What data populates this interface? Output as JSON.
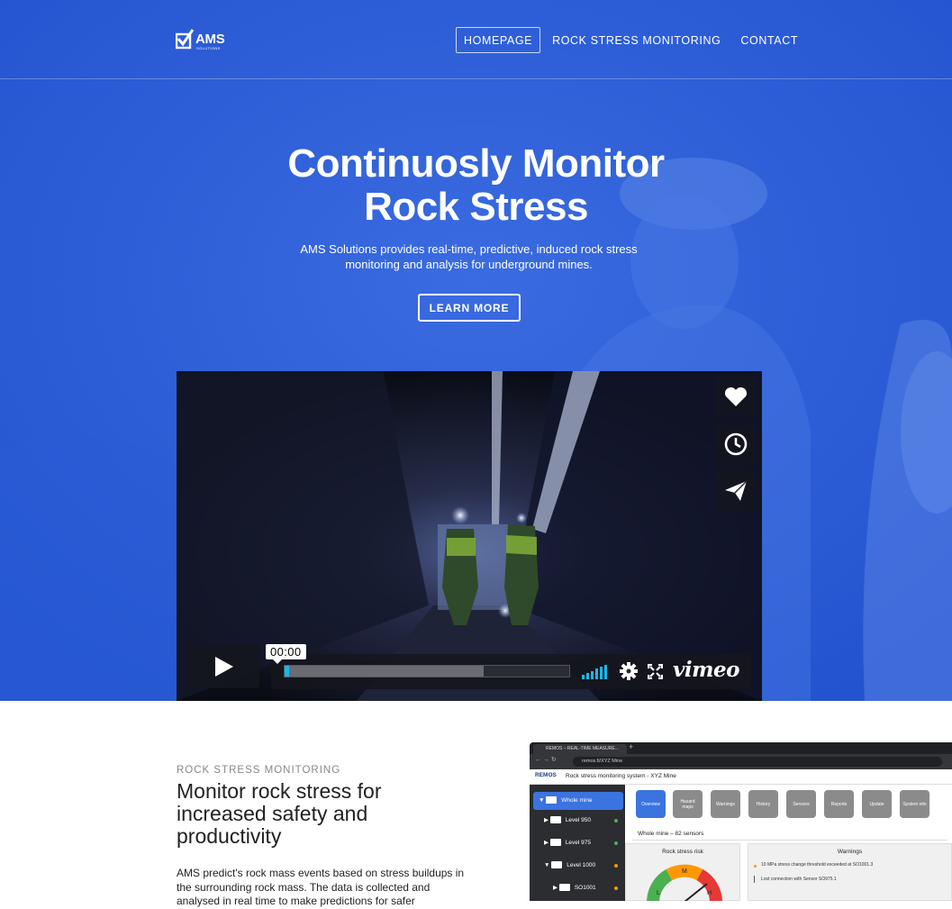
{
  "nav": {
    "logo_text": "AMS",
    "logo_sub": "SOLUTIONS",
    "links": [
      "HOMEPAGE",
      "ROCK STRESS MONITORING",
      "CONTACT"
    ]
  },
  "hero": {
    "title_line1": "Continuosly Monitor",
    "title_line2": "Rock Stress",
    "subtitle_line1": "AMS Solutions provides real-time, predictive, induced rock stress",
    "subtitle_line2": "monitoring and analysis for underground mines.",
    "cta": "LEARN MORE"
  },
  "video": {
    "time": "00:00",
    "brand": "vimeo",
    "progress_buffered": 0.7,
    "progress_played": 0.0,
    "side_icons": [
      "heart-icon",
      "clock-icon",
      "send-icon"
    ]
  },
  "section": {
    "kicker": "ROCK STRESS MONITORING",
    "title": "Monitor rock stress for increased safety and productivity",
    "body": "AMS predict's rock mass events based on stress buildups in the surrounding rock mass. The data is collected and analysed in real time to make predictions for safer"
  },
  "app_screenshot": {
    "tab_title": "REMOS – REAL-TIME MEASURE...",
    "url": "remos.fi/XYZ Mine",
    "logo": "REMOS",
    "header_title": "Rock stress monitoring system - XYZ Mine",
    "sidebar": [
      {
        "label": "Whole mine",
        "dot": ""
      },
      {
        "label": "Level 950",
        "dot": "#4caf50"
      },
      {
        "label": "Level 975",
        "dot": "#4caf50"
      },
      {
        "label": "Level 1000",
        "dot": "#ff9800"
      },
      {
        "label": "SO1001",
        "dot": "#ff9800"
      }
    ],
    "tabs": [
      "Overview",
      "Hazard maps",
      "Warnings",
      "History",
      "Sensors",
      "Reports",
      "Update",
      "System info"
    ],
    "breadcrumb": "Whole mine – 82 sensors",
    "panel_risk_title": "Rock stress risk",
    "panel_warn_title": "Warnings",
    "warnings": [
      "10 MPa stress change threshold exceeded at SO1001.3",
      "Lost connection with Sensor SO975.1"
    ],
    "gauge_labels": [
      "M",
      "L",
      "H"
    ]
  },
  "colors": {
    "hero_blue": "#2d5fd9",
    "vimeo_blue": "#1ab7ea",
    "app_accent": "#3b73e0"
  }
}
